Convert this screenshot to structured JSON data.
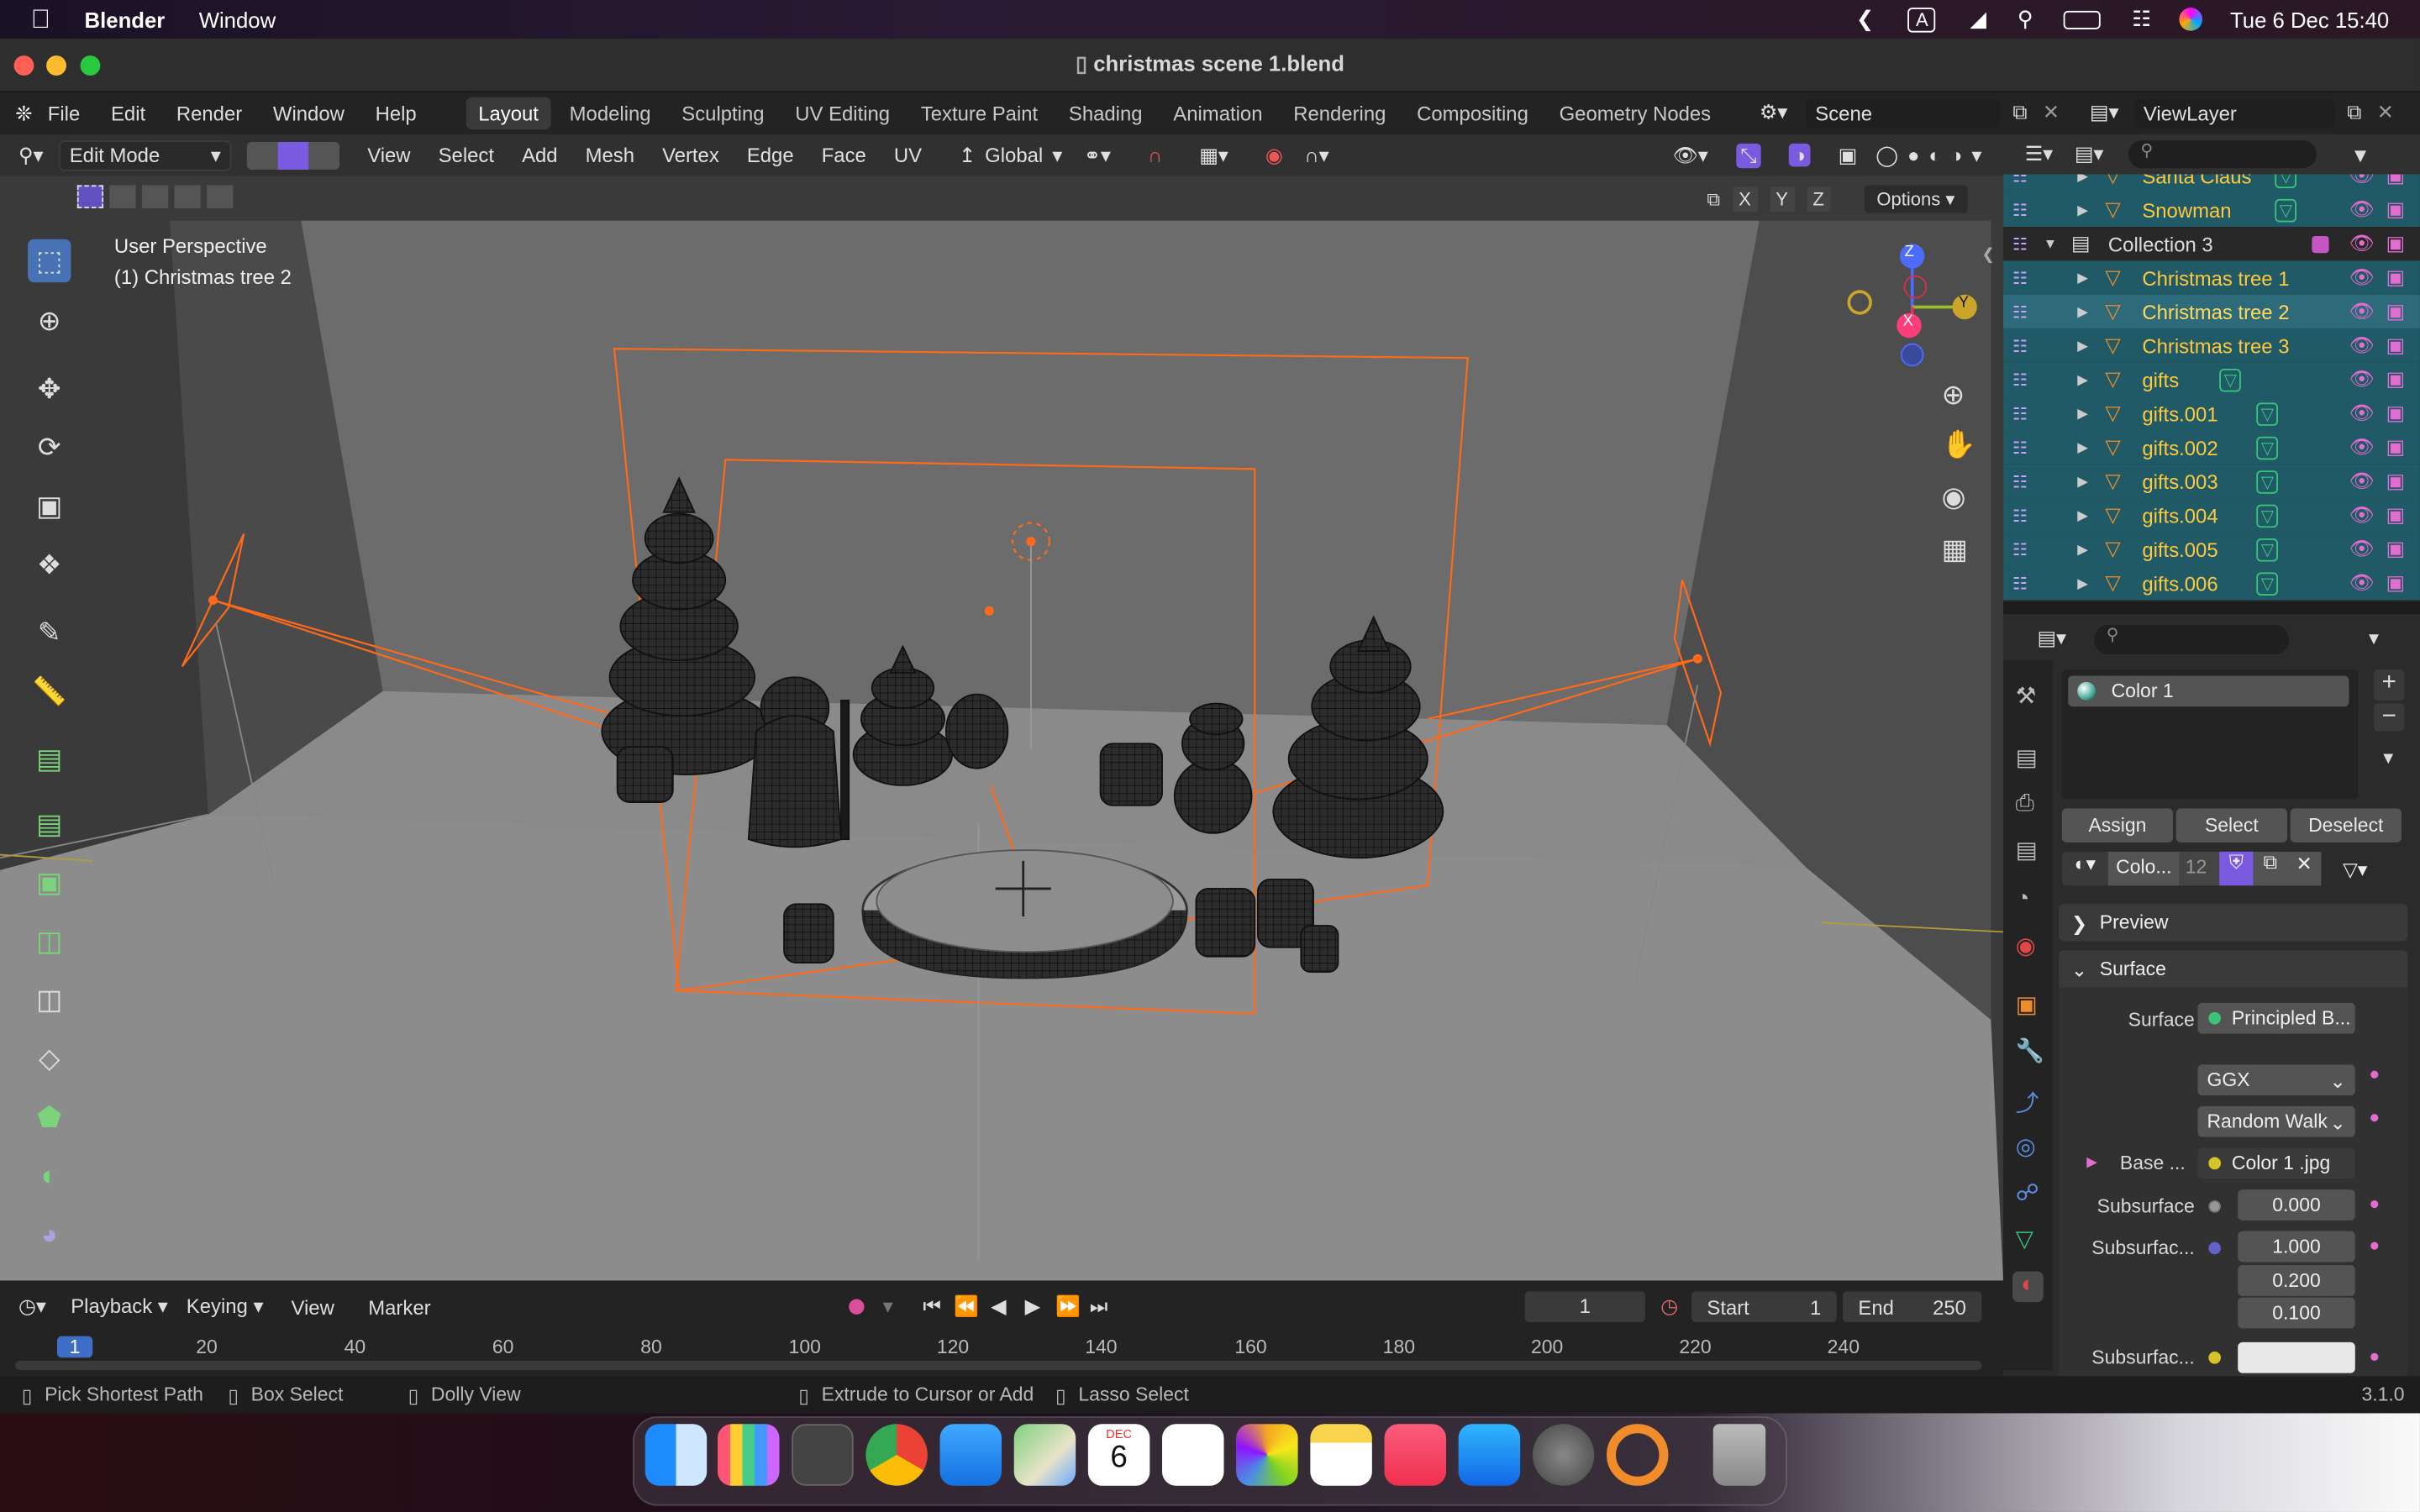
{
  "menubar": {
    "app": "Blender",
    "window": "Window",
    "datetime": "Tue 6 Dec  15:40",
    "input_badge": "A"
  },
  "window": {
    "title": "christmas scene 1.blend"
  },
  "blender_menu": [
    "File",
    "Edit",
    "Render",
    "Window",
    "Help"
  ],
  "workspaces": [
    "Layout",
    "Modeling",
    "Sculpting",
    "UV Editing",
    "Texture Paint",
    "Shading",
    "Animation",
    "Rendering",
    "Compositing",
    "Geometry Nodes"
  ],
  "active_workspace": "Layout",
  "scene": "Scene",
  "view_layer": "ViewLayer",
  "viewport_header": {
    "mode": "Edit Mode",
    "menus": [
      "View",
      "Select",
      "Add",
      "Mesh",
      "Vertex",
      "Edge",
      "Face",
      "UV"
    ],
    "orientation": "Global",
    "axes": [
      "X",
      "Y",
      "Z"
    ],
    "options": "Options"
  },
  "viewport": {
    "perspective": "User Perspective",
    "object": "(1) Christmas tree 2",
    "gizmo": {
      "z": "Z",
      "y": "Y",
      "x": "X"
    }
  },
  "outliner": {
    "rows": [
      {
        "name": "Santa Claus",
        "type": "mesh",
        "extra": true,
        "selected": false
      },
      {
        "name": "Snowman",
        "type": "mesh",
        "extra": true,
        "selected": false
      },
      {
        "name": "Collection 3",
        "type": "collection",
        "extra": false,
        "selected": false
      },
      {
        "name": "Christmas tree 1",
        "type": "mesh",
        "extra": false,
        "selected": false
      },
      {
        "name": "Christmas tree 2",
        "type": "mesh",
        "extra": false,
        "selected": true
      },
      {
        "name": "Christmas tree 3",
        "type": "mesh",
        "extra": false,
        "selected": false
      },
      {
        "name": "gifts",
        "type": "mesh",
        "extra": true,
        "selected": false
      },
      {
        "name": "gifts.001",
        "type": "mesh",
        "extra": true,
        "selected": false
      },
      {
        "name": "gifts.002",
        "type": "mesh",
        "extra": true,
        "selected": false
      },
      {
        "name": "gifts.003",
        "type": "mesh",
        "extra": true,
        "selected": false
      },
      {
        "name": "gifts.004",
        "type": "mesh",
        "extra": true,
        "selected": false
      },
      {
        "name": "gifts.005",
        "type": "mesh",
        "extra": true,
        "selected": false
      },
      {
        "name": "gifts.006",
        "type": "mesh",
        "extra": true,
        "selected": false
      }
    ]
  },
  "properties": {
    "material_slot": "Color 1",
    "buttons": {
      "assign": "Assign",
      "select": "Select",
      "deselect": "Deselect"
    },
    "material_name": "Colo...",
    "users": "12",
    "panels": {
      "preview": "Preview",
      "surface": "Surface"
    },
    "surface": {
      "label": "Surface",
      "value": "Principled B..."
    },
    "distribution": "GGX",
    "subsurface_method": "Random Walk",
    "base_color": {
      "label": "Base ...",
      "value": "Color 1 .jpg"
    },
    "subsurface": {
      "label": "Subsurface",
      "value": "0.000"
    },
    "subsurface_radius": {
      "label": "Subsurfac...",
      "values": [
        "1.000",
        "0.200",
        "0.100"
      ]
    },
    "subsurface_color": {
      "label": "Subsurfac..."
    }
  },
  "timeline": {
    "menus": [
      "Playback",
      "Keying",
      "View",
      "Marker"
    ],
    "current_frame": "1",
    "start_label": "Start",
    "start": "1",
    "end_label": "End",
    "end": "250",
    "ticks": [
      "1",
      "20",
      "40",
      "60",
      "80",
      "100",
      "120",
      "140",
      "160",
      "180",
      "200",
      "220",
      "240"
    ]
  },
  "statusbar": {
    "items": [
      "Pick Shortest Path",
      "Box Select",
      "Dolly View",
      "Extrude to Cursor or Add",
      "Lasso Select"
    ],
    "version": "3.1.0"
  },
  "dock": {
    "calendar_month": "DEC",
    "calendar_day": "6"
  }
}
